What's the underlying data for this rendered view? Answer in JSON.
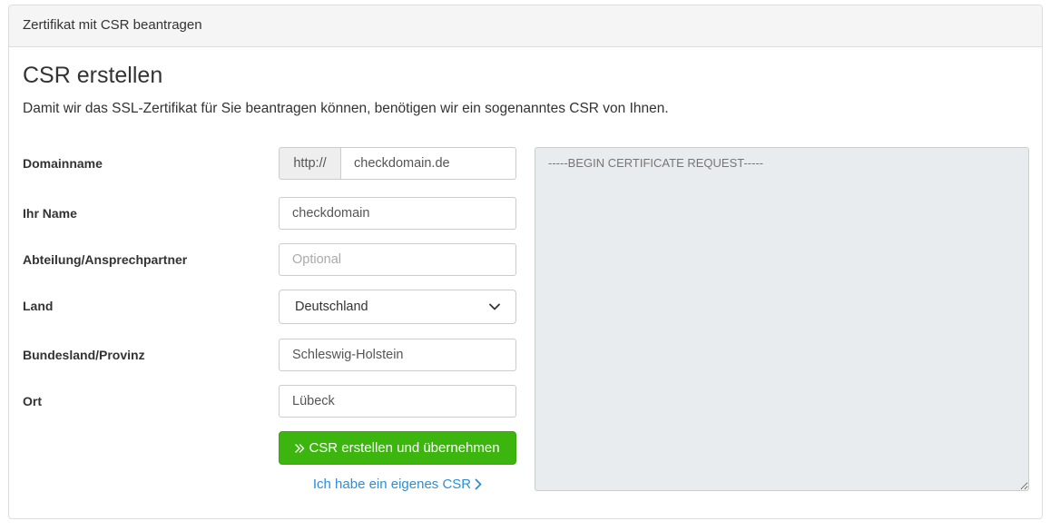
{
  "panel": {
    "heading": "Zertifikat mit CSR beantragen"
  },
  "main": {
    "title": "CSR erstellen",
    "description": "Damit wir das SSL-Zertifikat für Sie beantragen können, benötigen wir ein sogenanntes CSR von Ihnen."
  },
  "form": {
    "domain": {
      "label": "Domainname",
      "prefix": "http://",
      "value": "checkdomain.de"
    },
    "name": {
      "label": "Ihr Name",
      "value": "checkdomain"
    },
    "department": {
      "label": "Abteilung/Ansprechpartner",
      "value": "",
      "placeholder": "Optional"
    },
    "country": {
      "label": "Land",
      "selected": "Deutschland"
    },
    "state": {
      "label": "Bundesland/Provinz",
      "value": "Schleswig-Holstein"
    },
    "city": {
      "label": "Ort",
      "value": "Lübeck"
    },
    "submit_label": "CSR erstellen und übernehmen",
    "own_csr_label": "Ich habe ein eigenes CSR"
  },
  "csr": {
    "placeholder": "-----BEGIN CERTIFICATE REQUEST-----"
  },
  "colors": {
    "accent_green": "#3cb50f",
    "link_blue": "#2a8fd8",
    "textarea_bg": "#e9ecef"
  },
  "icons": {
    "submit": "double-chevron-right-icon",
    "own_csr": "chevron-right-icon",
    "select": "chevron-down-icon"
  }
}
